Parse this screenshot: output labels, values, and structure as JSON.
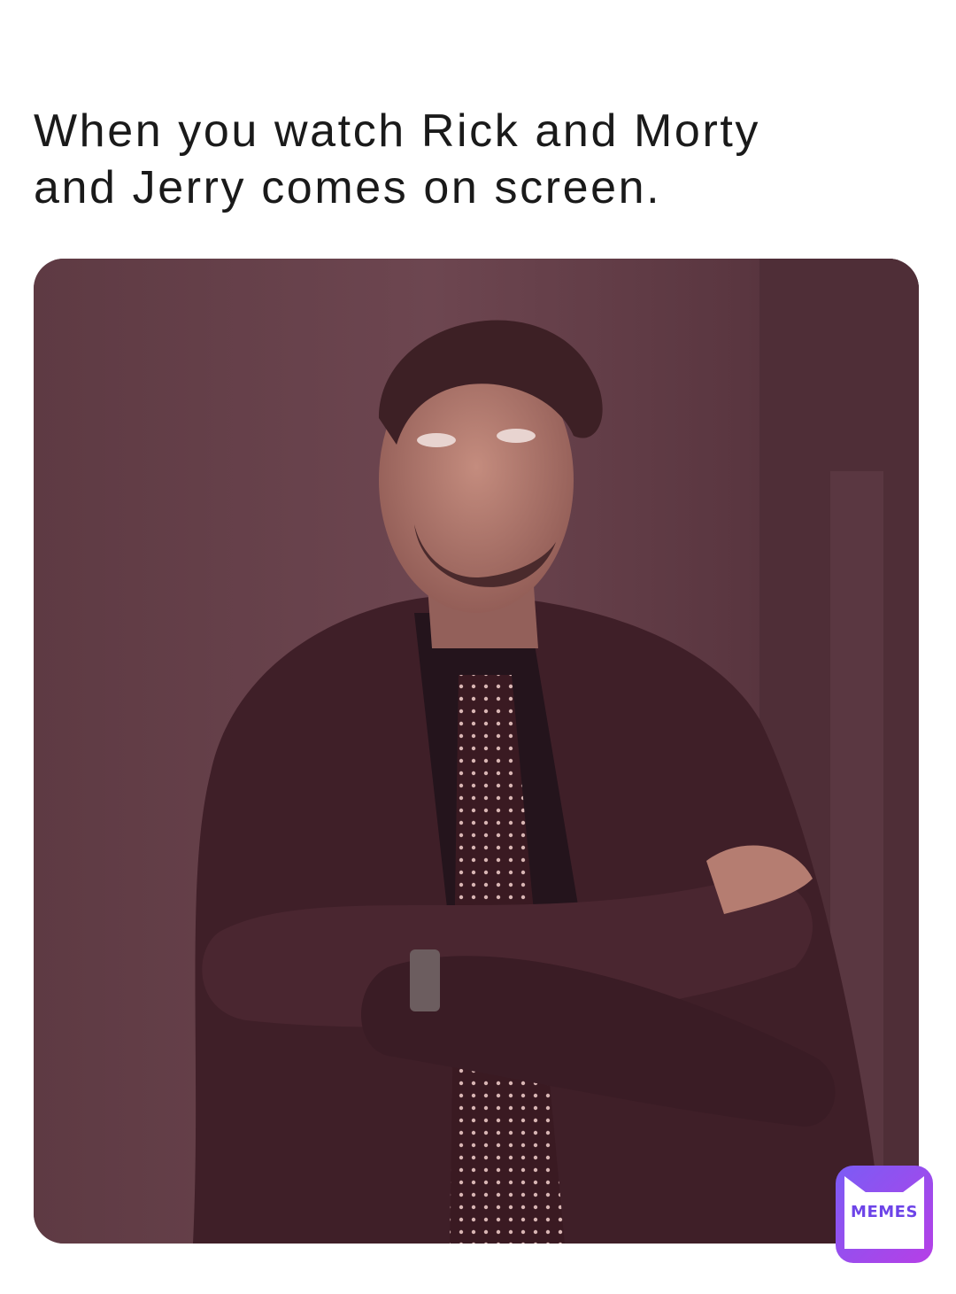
{
  "caption": {
    "line1": "When you watch Rick and Morty",
    "line2": "and Jerry comes on screen."
  },
  "badge": {
    "label": "MEMES",
    "icon": "envelope-icon",
    "color_top": "#7b5cf5",
    "color_bottom": "#b63fe6"
  },
  "image": {
    "subject": "man-eye-roll-crossed-arms",
    "tint": "#5b3440"
  }
}
